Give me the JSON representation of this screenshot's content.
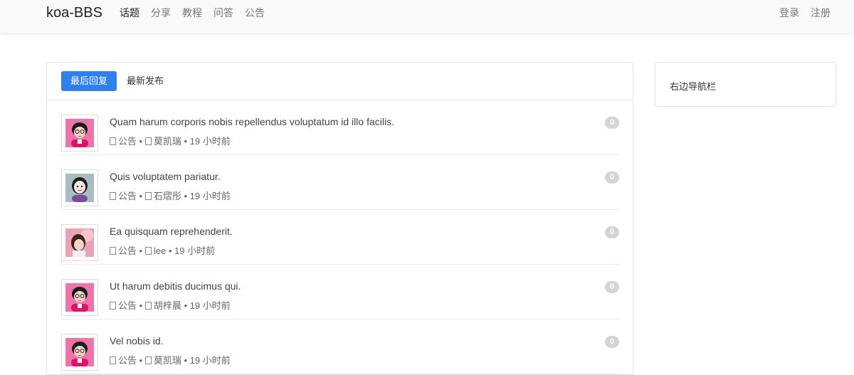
{
  "navbar": {
    "brand": "koa-BBS",
    "links": [
      "话题",
      "分享",
      "教程",
      "问答",
      "公告"
    ],
    "right": [
      "登录",
      "注册"
    ]
  },
  "tabs": [
    "最后回复",
    "最新发布"
  ],
  "topics": [
    {
      "title": "Quam harum corporis nobis repellendus voluptatum id illo facilis.",
      "category": "公告",
      "author": "莫凯瑞",
      "time": "19 小时前",
      "replies": "0",
      "avatar": "cartoon-pink"
    },
    {
      "title": "Quis voluptatem pariatur.",
      "category": "公告",
      "author": "石熠彤",
      "time": "19 小时前",
      "replies": "0",
      "avatar": "cartoon-gray"
    },
    {
      "title": "Ea quisquam reprehenderit.",
      "category": "公告",
      "author": "lee",
      "time": "19 小时前",
      "replies": "0",
      "avatar": "photo-girl"
    },
    {
      "title": "Ut harum debitis ducimus qui.",
      "category": "公告",
      "author": "胡梓晨",
      "time": "19 小时前",
      "replies": "0",
      "avatar": "cartoon-pink"
    },
    {
      "title": "Vel nobis id.",
      "category": "公告",
      "author": "莫凯瑞",
      "time": "19 小时前",
      "replies": "0",
      "avatar": "cartoon-pink"
    }
  ],
  "sidebar": {
    "title": "右边导航栏"
  },
  "meta_separator": "•"
}
